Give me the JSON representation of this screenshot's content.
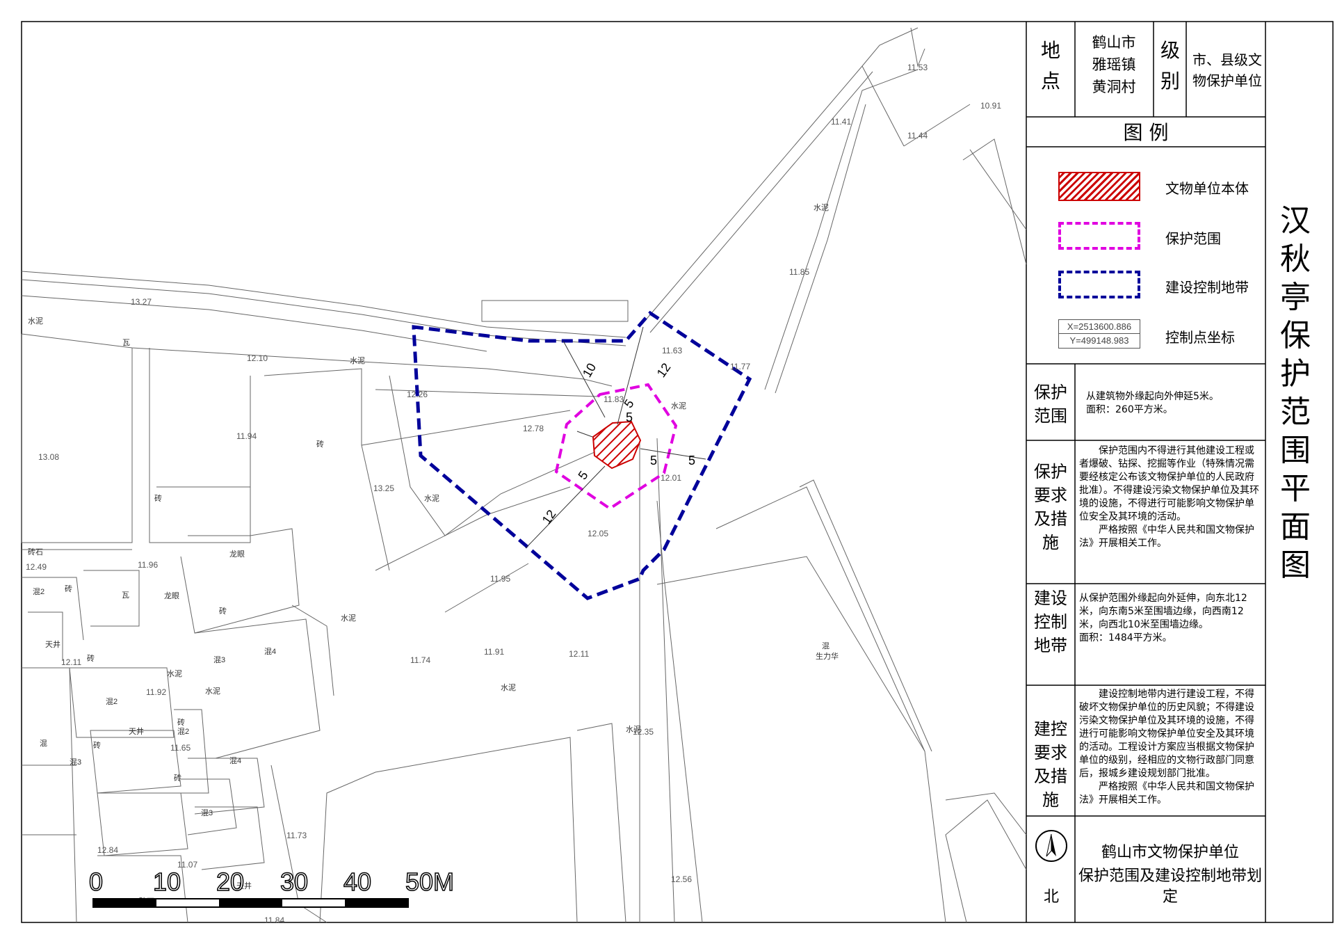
{
  "title": "汉秋亭保护范围平面图",
  "info": {
    "location_label": "地点",
    "location_value": "鹤山市雅瑶镇黄洞村",
    "level_label": "级别",
    "level_value": "市、县级文物保护单位"
  },
  "legend": {
    "header": "图 例",
    "items": [
      {
        "label": "文物单位本体",
        "icon": "hatched-red-box"
      },
      {
        "label": "保护范围",
        "icon": "magenta-dashed-box"
      },
      {
        "label": "建设控制地带",
        "icon": "blue-dashed-box"
      },
      {
        "label": "控制点坐标",
        "icon": "coordinate-box",
        "x_text": "X=2513600.886",
        "y_text": "Y=499148.983"
      }
    ]
  },
  "sections": [
    {
      "label": "保护范围",
      "lines": [
        "从建筑物外缘起向外伸延5米。",
        "面积：260平方米。"
      ]
    },
    {
      "label": "保护要求及措施",
      "lines": [
        "保护范围内不得进行其他建设工程或者爆破、钻探、挖掘等作业（特殊情况需要经核定公布该文物保护单位的人民政府批准）。不得建设污染文物保护单位及其环境的设施，不得进行可能影响文物保护单位安全及其环境的活动。",
        "严格按照《中华人民共和国文物保护法》开展相关工作。"
      ]
    },
    {
      "label": "建设控制地带",
      "lines": [
        "从保护范围外缘起向外延伸，向东北12米，向东南5米至围墙边缘，向西南12米，向西北10米至围墙边缘。",
        "面积：1484平方米。"
      ]
    },
    {
      "label": "建控要求及措施",
      "lines": [
        "建设控制地带内进行建设工程，不得破坏文物保护单位的历史风貌；不得建设污染文物保护单位及其环境的设施，不得进行可能影响文物保护单位安全及其环境的活动。工程设计方案应当根据文物保护单位的级别，经相应的文物行政部门同意后，报城乡建设规划部门批准。",
        "严格按照《中华人民共和国文物保护法》开展相关工作。"
      ]
    }
  ],
  "footer": {
    "north_label": "北",
    "line1": "鹤山市文物保护单位",
    "line2": "保护范围及建设控制地带划定"
  },
  "scale_bar": {
    "ticks": [
      "0",
      "10",
      "20",
      "30",
      "40",
      "50M"
    ]
  },
  "map": {
    "dimensions": [
      "10",
      "12",
      "5",
      "5",
      "5",
      "5",
      "5",
      "12"
    ],
    "elevations": [
      "13.27",
      "12.10",
      "12.26",
      "11.83",
      "12.78",
      "13.25",
      "12.05",
      "11.95",
      "11.96",
      "12.49",
      "12.11",
      "11.92",
      "11.74",
      "11.91",
      "12.11",
      "11.63",
      "11.77",
      "11.85",
      "11.53",
      "11.41",
      "11.44",
      "10.91",
      "12.01",
      "11.73",
      "12.35",
      "12.56",
      "12.84",
      "11.07",
      "11.65",
      "13.08",
      "11.94",
      "11.84"
    ],
    "labels": [
      "水泥",
      "水泥",
      "水泥",
      "水泥",
      "水泥",
      "水泥",
      "水泥",
      "水泥",
      "水泥",
      "水泥",
      "砖",
      "砖",
      "砖",
      "砖",
      "砖",
      "砖",
      "砖",
      "砖",
      "瓦",
      "瓦",
      "砖石",
      "砖石",
      "天井",
      "天井",
      "天井",
      "龙眼",
      "龙眼",
      "混",
      "混",
      "混2",
      "混2",
      "混2",
      "混3",
      "混3",
      "混3",
      "混4",
      "混4",
      "生力华"
    ]
  },
  "colors": {
    "protection": "#e000e0",
    "control": "#00009a",
    "heritage": "#cc0000",
    "line": "#555555"
  }
}
